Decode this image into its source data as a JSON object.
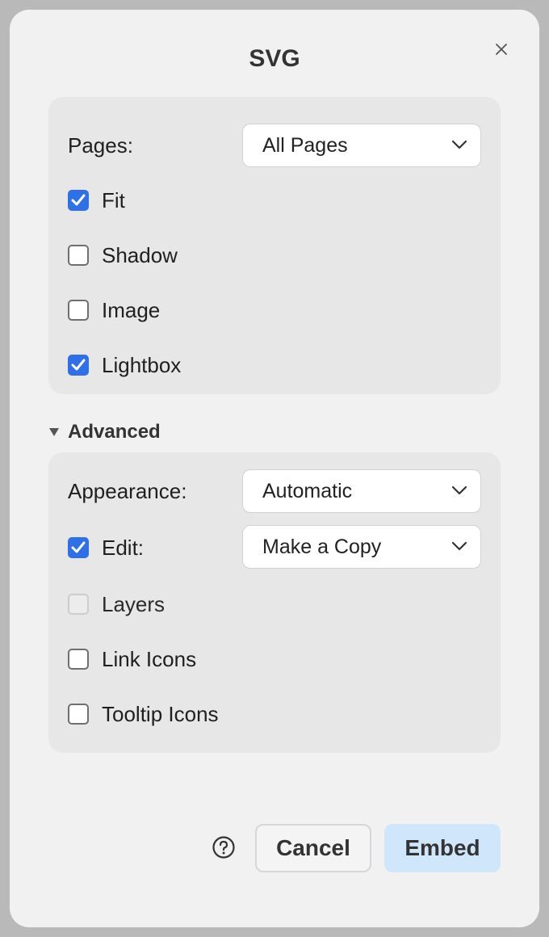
{
  "dialog": {
    "title": "SVG",
    "close_icon": "close-icon"
  },
  "main": {
    "pages_label": "Pages:",
    "pages_value": "All Pages",
    "options": [
      {
        "label": "Fit",
        "checked": true
      },
      {
        "label": "Shadow",
        "checked": false
      },
      {
        "label": "Image",
        "checked": false
      },
      {
        "label": "Lightbox",
        "checked": true
      }
    ]
  },
  "advanced": {
    "toggle_label": "Advanced",
    "expanded": true,
    "appearance_label": "Appearance:",
    "appearance_value": "Automatic",
    "edit_label": "Edit:",
    "edit_checked": true,
    "edit_value": "Make a Copy",
    "options": [
      {
        "label": "Layers",
        "checked": false,
        "disabled": true
      },
      {
        "label": "Link Icons",
        "checked": false,
        "disabled": false
      },
      {
        "label": "Tooltip Icons",
        "checked": false,
        "disabled": false
      }
    ]
  },
  "footer": {
    "help_icon": "help-icon",
    "cancel_label": "Cancel",
    "embed_label": "Embed"
  },
  "colors": {
    "accent": "#2f6fe8",
    "primary_button": "#cfe6fb",
    "panel": "#e7e7e7",
    "dialog": "#f1f1f1"
  }
}
